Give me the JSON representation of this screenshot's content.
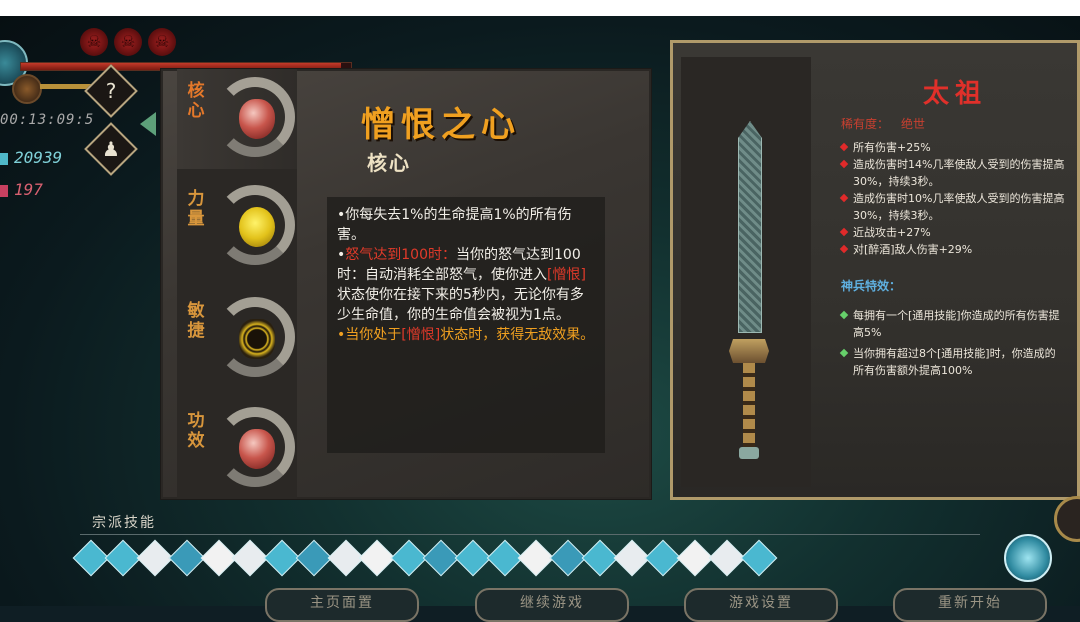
{
  "hud": {
    "timer": "00:13:09:5",
    "soul_count": "20939",
    "gold_count": "197",
    "help_symbol": "?"
  },
  "tabs": [
    {
      "label": "核心",
      "icon": "heart-icon"
    },
    {
      "label": "力量",
      "icon": "golden-toad-icon"
    },
    {
      "label": "敏捷",
      "icon": "golden-coil-icon"
    },
    {
      "label": "功效",
      "icon": "heart-icon"
    }
  ],
  "item": {
    "title": "憎恨之心",
    "subtitle": "核心",
    "desc_1": "•你每失去1%的生命提高1%的所有伤害。",
    "desc_2_highlight": "怒气达到100时：",
    "desc_2_body": "当你的怒气达到100时：自动消耗全部怒气，使你进入",
    "desc_2_hate": "[憎恨]",
    "desc_2_end": "状态使你在接下来的5秒内，无论你有多少生命值，你的生命值会被视为1点。",
    "desc_3_start": "•当你处于",
    "desc_3_hate": "[憎恨]",
    "desc_3_end": "状态时，获得无敌效果。"
  },
  "weapon": {
    "name": "太祖",
    "rarity_label": "稀有度：",
    "rarity_value": "绝世",
    "stats": [
      "所有伤害+25%",
      "造成伤害时14%几率使敌人受到的伤害提高30%，持续3秒。",
      "造成伤害时10%几率使敌人受到的伤害提高30%，持续3秒。",
      "近战攻击+27%",
      "对[醉酒]敌人伤害+29%"
    ],
    "special_header": "神兵特效：",
    "specials": [
      "每拥有一个[通用技能]你造成的所有伤害提高5%",
      "当你拥有超过8个[通用技能]时，你造成的所有伤害额外提高100%"
    ]
  },
  "skills_title": "宗派技能",
  "skill_count": 22,
  "menu": {
    "btn1": "主页面置",
    "btn2": "继续游戏",
    "btn3": "游戏设置",
    "btn4": "重新开始"
  }
}
